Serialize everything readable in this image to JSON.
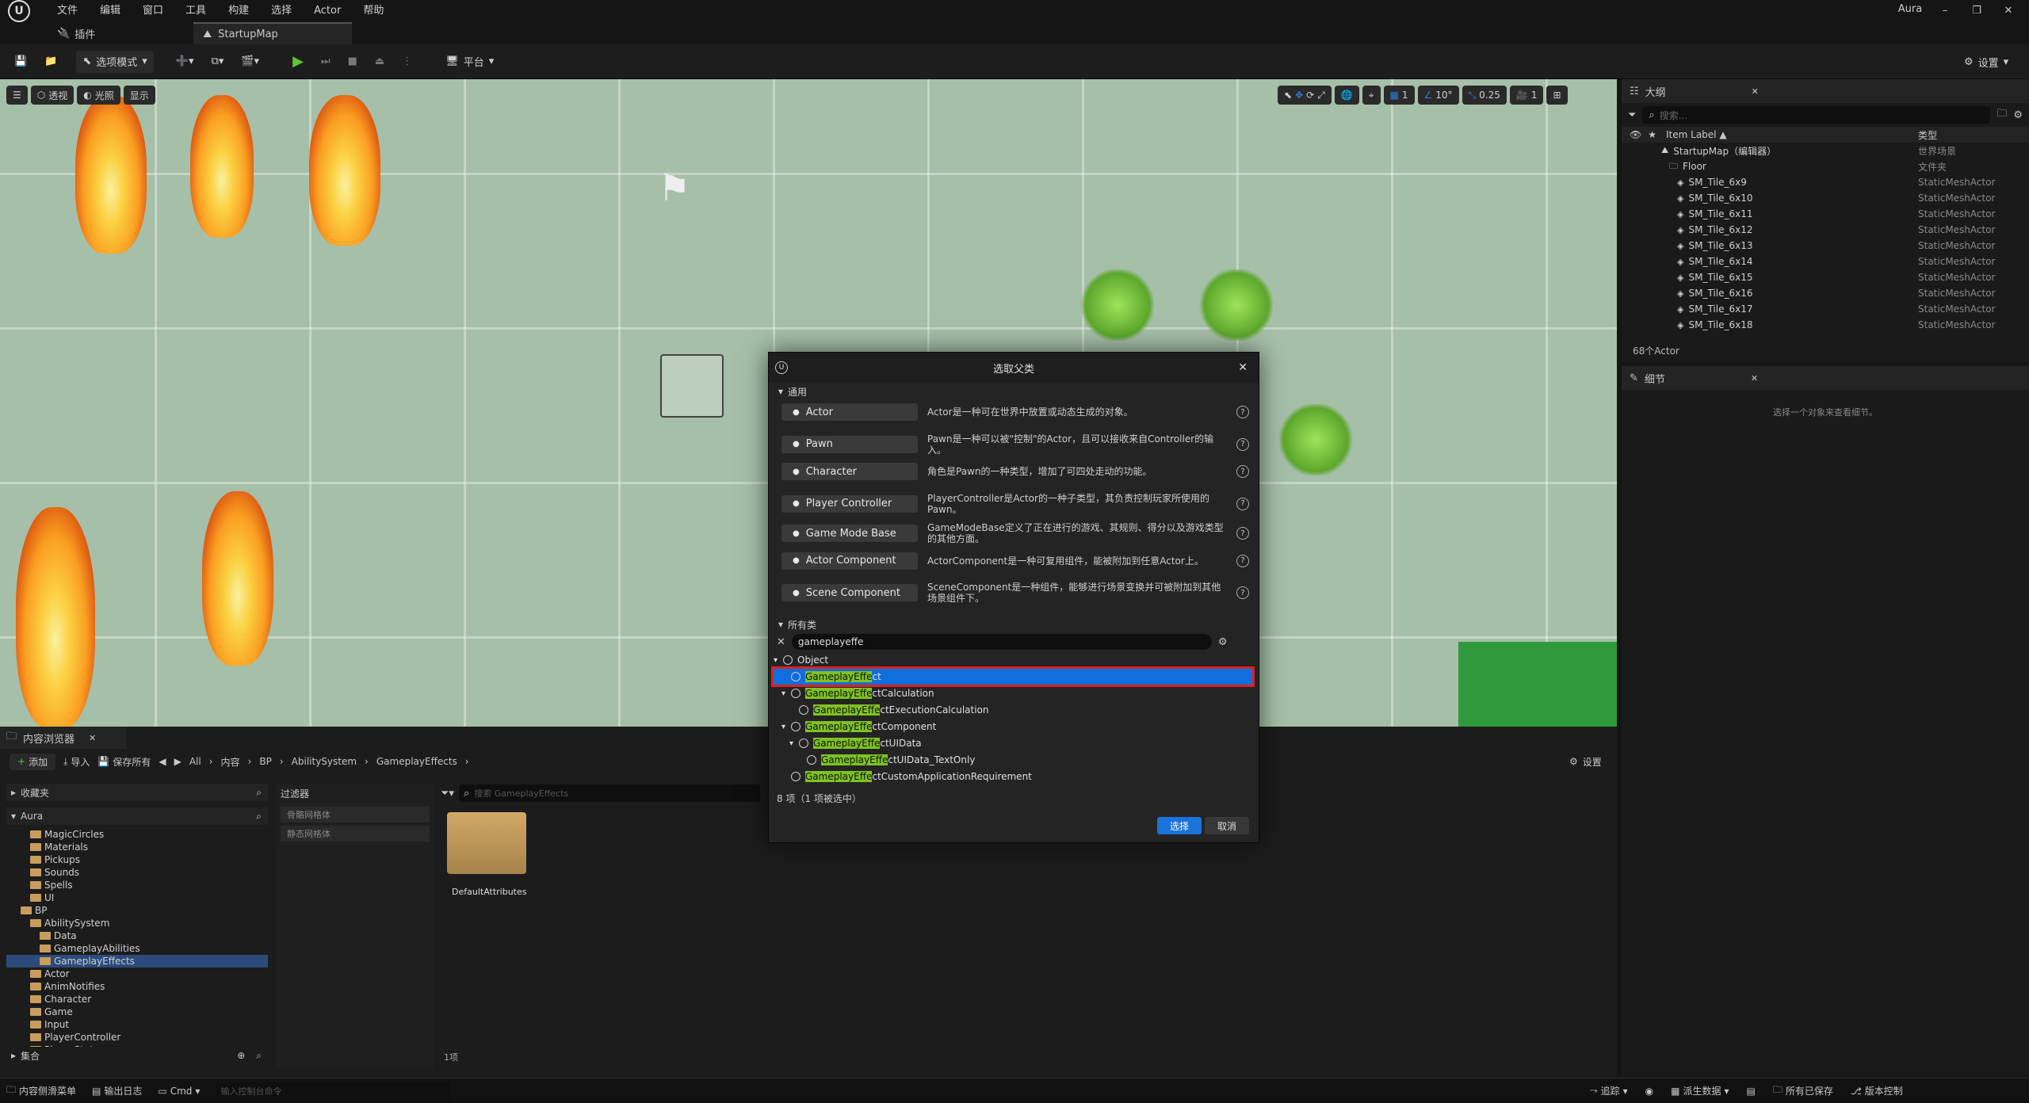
{
  "menu": [
    "文件",
    "编辑",
    "窗口",
    "工具",
    "构建",
    "选择",
    "Actor",
    "帮助"
  ],
  "project_name": "Aura",
  "tabs": {
    "plugins": "插件",
    "map": "StartupMap"
  },
  "toolbar": {
    "mode": "选项模式",
    "platform": "平台",
    "settings": "设置"
  },
  "viewport": {
    "perspective": "透视",
    "lit": "光照",
    "show": "显示",
    "grid": "1",
    "angle": "10°",
    "speed": "0.25",
    "camera": "1"
  },
  "outliner": {
    "title": "大纲",
    "search_placeholder": "搜索...",
    "col_label": "Item Label ▲",
    "col_type": "类型",
    "rows": [
      {
        "label": "StartupMap（编辑器）",
        "type": "世界场景",
        "indent": 1
      },
      {
        "label": "Floor",
        "type": "文件夹",
        "indent": 2
      },
      {
        "label": "SM_Tile_6x9",
        "type": "StaticMeshActor",
        "indent": 3
      },
      {
        "label": "SM_Tile_6x10",
        "type": "StaticMeshActor",
        "indent": 3
      },
      {
        "label": "SM_Tile_6x11",
        "type": "StaticMeshActor",
        "indent": 3
      },
      {
        "label": "SM_Tile_6x12",
        "type": "StaticMeshActor",
        "indent": 3
      },
      {
        "label": "SM_Tile_6x13",
        "type": "StaticMeshActor",
        "indent": 3
      },
      {
        "label": "SM_Tile_6x14",
        "type": "StaticMeshActor",
        "indent": 3
      },
      {
        "label": "SM_Tile_6x15",
        "type": "StaticMeshActor",
        "indent": 3
      },
      {
        "label": "SM_Tile_6x16",
        "type": "StaticMeshActor",
        "indent": 3
      },
      {
        "label": "SM_Tile_6x17",
        "type": "StaticMeshActor",
        "indent": 3
      },
      {
        "label": "SM_Tile_6x18",
        "type": "StaticMeshActor",
        "indent": 3
      }
    ],
    "count": "68个Actor"
  },
  "details": {
    "title": "细节",
    "empty": "选择一个对象来查看细节。"
  },
  "content_browser": {
    "title": "内容浏览器",
    "add": "添加",
    "import": "导入",
    "save_all": "保存所有",
    "path": [
      "All",
      "内容",
      "BP",
      "AbilitySystem",
      "GameplayEffects"
    ],
    "settings": "设置",
    "favorites": "收藏夹",
    "root": "Aura",
    "filters": "过滤器",
    "filter_items": [
      "骨骼网格体",
      "静态网格体"
    ],
    "search_placeholder": "搜索 GameplayEffects",
    "folder_name": "DefaultAttributes",
    "item_count": "1项",
    "collections": "集合",
    "tree": [
      {
        "label": "MagicCircles",
        "indent": 2
      },
      {
        "label": "Materials",
        "indent": 2
      },
      {
        "label": "Pickups",
        "indent": 2
      },
      {
        "label": "Sounds",
        "indent": 2
      },
      {
        "label": "Spells",
        "indent": 2
      },
      {
        "label": "UI",
        "indent": 2
      },
      {
        "label": "BP",
        "indent": 1
      },
      {
        "label": "AbilitySystem",
        "indent": 2
      },
      {
        "label": "Data",
        "indent": 3
      },
      {
        "label": "GameplayAbilities",
        "indent": 3
      },
      {
        "label": "GameplayEffects",
        "indent": 3,
        "selected": true
      },
      {
        "label": "Actor",
        "indent": 2
      },
      {
        "label": "AnimNotifies",
        "indent": 2
      },
      {
        "label": "Character",
        "indent": 2
      },
      {
        "label": "Game",
        "indent": 2
      },
      {
        "label": "Input",
        "indent": 2
      },
      {
        "label": "PlayerController",
        "indent": 2
      },
      {
        "label": "PlayerState",
        "indent": 2
      }
    ]
  },
  "dialog": {
    "title": "选取父类",
    "common_header": "通用",
    "all_header": "所有类",
    "search_value": "gameplayeffe",
    "common": [
      {
        "label": "Actor",
        "desc": "Actor是一种可在世界中放置或动态生成的对象。"
      },
      {
        "label": "Pawn",
        "desc": "Pawn是一种可以被\"控制\"的Actor，且可以接收来自Controller的输入。"
      },
      {
        "label": "Character",
        "desc": "角色是Pawn的一种类型，增加了可四处走动的功能。"
      },
      {
        "label": "Player Controller",
        "desc": "PlayerController是Actor的一种子类型，其负责控制玩家所使用的Pawn。"
      },
      {
        "label": "Game Mode Base",
        "desc": "GameModeBase定义了正在进行的游戏、其规则、得分以及游戏类型的其他方面。"
      },
      {
        "label": "Actor Component",
        "desc": "ActorComponent是一种可复用组件，能被附加到任意Actor上。"
      },
      {
        "label": "Scene Component",
        "desc": "SceneComponent是一种组件，能够进行场景变换并可被附加到其他场景组件下。"
      }
    ],
    "classes": [
      {
        "pre": "",
        "hl": "",
        "post": "Object",
        "indent": 0
      },
      {
        "pre": "",
        "hl": "GameplayEffe",
        "post": "ct",
        "indent": 1,
        "selected": true
      },
      {
        "pre": "",
        "hl": "GameplayEffe",
        "post": "ctCalculation",
        "indent": 1
      },
      {
        "pre": "",
        "hl": "GameplayEffe",
        "post": "ctExecutionCalculation",
        "indent": 2
      },
      {
        "pre": "",
        "hl": "GameplayEffe",
        "post": "ctComponent",
        "indent": 1
      },
      {
        "pre": "",
        "hl": "GameplayEffe",
        "post": "ctUIData",
        "indent": 2
      },
      {
        "pre": "",
        "hl": "GameplayEffe",
        "post": "ctUIData_TextOnly",
        "indent": 3
      },
      {
        "pre": "",
        "hl": "GameplayEffe",
        "post": "ctCustomApplicationRequirement",
        "indent": 1
      }
    ],
    "count": "8 项（1 项被选中）",
    "select": "选择",
    "cancel": "取消"
  },
  "statusbar": {
    "drawer": "内容侧滑菜单",
    "output": "输出日志",
    "cmd": "Cmd",
    "cmd_placeholder": "输入控制台命令",
    "trace": "追踪",
    "derived": "派生数据",
    "save_all": "所有已保存",
    "source": "版本控制"
  }
}
